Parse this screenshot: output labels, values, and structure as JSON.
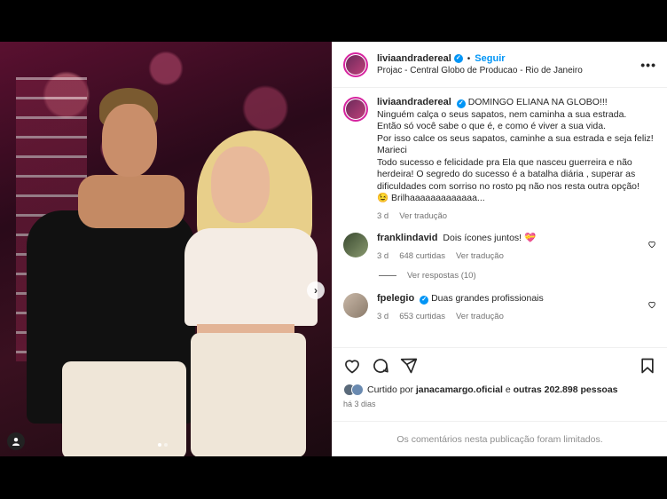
{
  "post": {
    "username": "liviaandradereal",
    "follow_label": "Seguir",
    "separator": "•",
    "location": "Projac - Central Globo de Producao - Rio de Janeiro",
    "more_label": "•••"
  },
  "caption": {
    "username": "liviaandradereal",
    "lines": [
      "DOMINGO ELIANA NA GLOBO!!!",
      "Ninguém calça o seus sapatos, nem caminha a sua estrada.",
      "Então só você sabe o que é, e como é viver a sua vida.",
      "Por isso calce os seus sapatos, caminhe a sua estrada e seja feliz!",
      "Marieci",
      "Todo sucesso e felicidade pra Ela que nasceu guerreira e não herdeira! O segredo do sucesso é a batalha diária , superar as dificuldades com sorriso no rosto pq não nos resta outra opção!",
      "😉 Brilhaaaaaaaaaaaaa..."
    ],
    "time": "3 d",
    "translate": "Ver tradução"
  },
  "comments": [
    {
      "username": "franklindavid",
      "text": "Dois ícones juntos! 💝",
      "time": "3 d",
      "likes": "648 curtidas",
      "translate": "Ver tradução",
      "replies": "Ver respostas (10)"
    },
    {
      "username": "fpelegio",
      "text": "Duas grandes profissionais",
      "time": "3 d",
      "likes": "653 curtidas",
      "translate": "Ver tradução"
    }
  ],
  "actions": {
    "liked_by_prefix": "Curtido por",
    "liked_by_user": "janacamargo.oficial",
    "liked_by_mid": "e",
    "liked_by_others": "outras 202.898 pessoas",
    "ago": "há 3 dias",
    "comments_limited": "Os comentários nesta publicação foram limitados."
  },
  "media": {
    "next_glyph": "›",
    "carousel_total": 2,
    "carousel_index": 1
  },
  "colors": {
    "accent": "#0095f6",
    "story_ring": "#d6249f",
    "muted": "#737373"
  },
  "icons": [
    "heart-icon",
    "comment-icon",
    "share-icon",
    "bookmark-icon",
    "more-icon",
    "user-tag-icon",
    "next-arrow-icon",
    "verified-badge-icon"
  ]
}
